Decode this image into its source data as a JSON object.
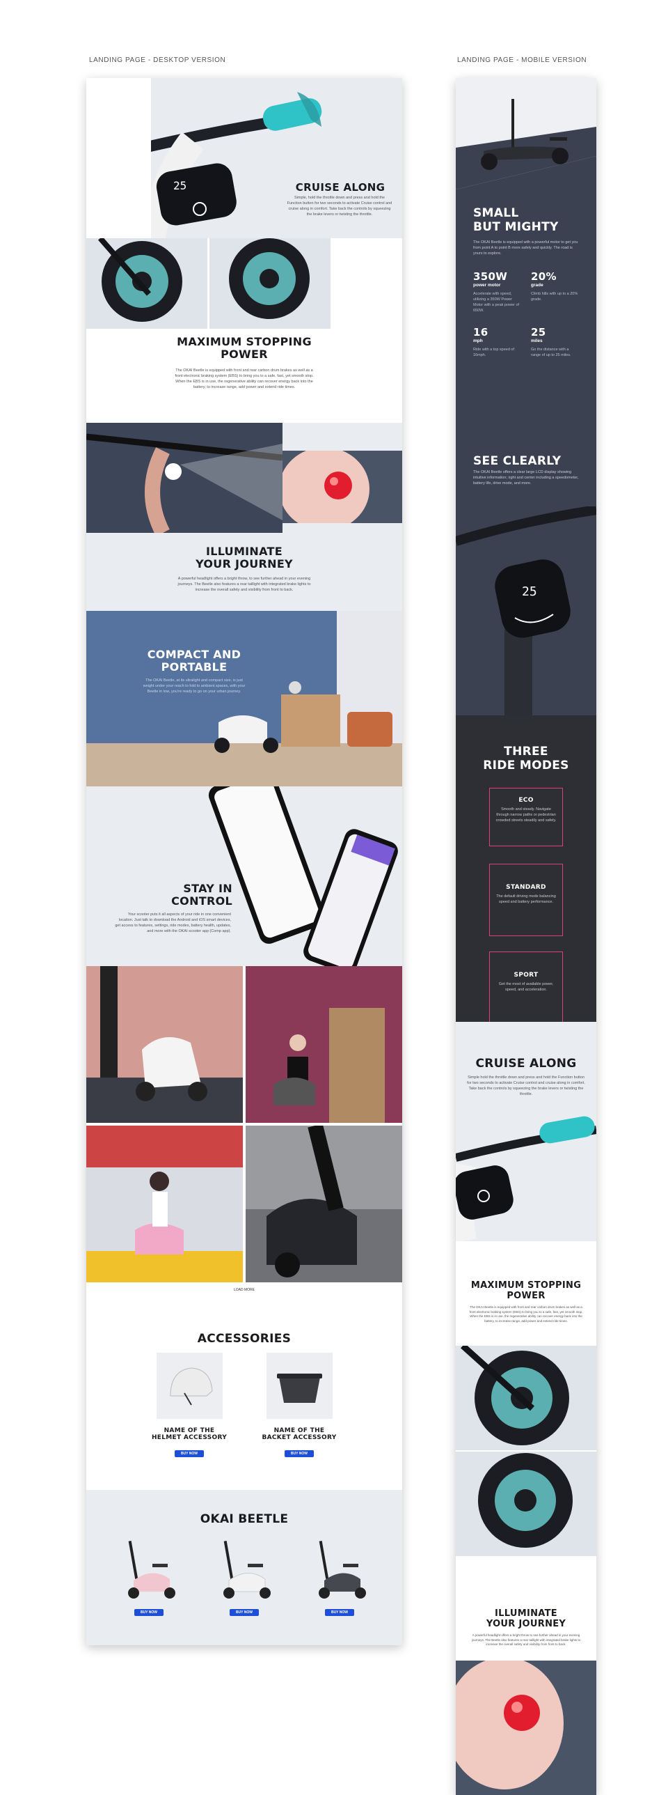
{
  "captions": {
    "desktop": "LANDING PAGE - DESKTOP VERSION",
    "mobile": "LANDING PAGE - MOBILE VERSION"
  },
  "display_readout": "25",
  "colors": {
    "accent": "#2fc3c7",
    "button": "#1d4ed8",
    "slate": "#3b4150",
    "pink": "#e0407a"
  },
  "desktop": {
    "cruise": {
      "title": "CRUISE ALONG",
      "text": "Simple, hold the throttle down and press and hold the Function button for two seconds to activate Cruise control and cruise along in comfort. Take back the controls by squeezing the brake levers or twisting the throttle."
    },
    "stopping": {
      "title_1": "MAXIMUM STOPPING",
      "title_2": "POWER",
      "text": "The OKAI Beetle is equipped with front and rear carbon drum brakes as well as a front electronic braking system (EBS) to bring you to a safe, fast, yet smooth stop. When the EBS is in use, the regenerative ability can recover energy back into the battery, to increase range, add power and extend ride times."
    },
    "illuminate": {
      "title_1": "ILLUMINATE",
      "title_2": "YOUR JOURNEY",
      "text": "A powerful headlight offers a bright throw, to see further ahead in your evening journeys. The Beetle also features a rear taillight with integrated brake lights to increase the overall safety and visibility from front to back."
    },
    "compact": {
      "title_1": "COMPACT AND",
      "title_2": "PORTABLE",
      "text": "The OKAI Beetle, at its ultralight and compact size, is just weight under your reach to fold to ambient spaces, with your Beetle in tow, you’re ready to go on your urban journey."
    },
    "control": {
      "title_1": "STAY IN",
      "title_2": "CONTROL",
      "text": "Your scooter puts it all aspects of your ride in one convenient location. Just talk to download the Android and iOS smart devices, get access to features, settings, ride modes, battery health, updates, and more with the OKAI scooter app (Comp app)."
    },
    "load_more": "LOAD MORE",
    "accessories": {
      "title": "ACCESSORIES",
      "items": [
        {
          "name_1": "NAME OF THE",
          "name_2": "HELMET ACCESSORY",
          "button": "BUY NOW"
        },
        {
          "name_1": "NAME OF THE",
          "name_2": "BACKET ACCESSORY",
          "button": "BUY NOW"
        }
      ]
    },
    "beetle": {
      "title": "OKAI BEETLE",
      "buttons": [
        "BUY NOW",
        "BUY NOW",
        "BUY NOW"
      ],
      "scooter_colors": [
        "#f2c6cf",
        "#f2f2f2",
        "#45484f"
      ]
    }
  },
  "mobile": {
    "small": {
      "title_1": "SMALL",
      "title_2": "BUT MIGHTY",
      "text": "The OKAI Beetle is equipped with a powerful motor to get you from point A to point B more safely and quickly. The road is yours to explore.",
      "stats": [
        {
          "value": "350W",
          "label": "power motor",
          "desc": "Accelerate with speed, utilizing a 350W Power Motor with a peak power of 650W."
        },
        {
          "value": "20%",
          "label": "grade",
          "desc": "Climb hills with up to a 20% grade."
        },
        {
          "value": "16",
          "label": "mph",
          "desc": "Ride with a top speed of 16mph."
        },
        {
          "value": "25",
          "label": "miles",
          "desc": "Go the distance with a range of up to 25 miles."
        }
      ]
    },
    "see": {
      "title": "SEE CLEARLY",
      "text": "The OKAI Beetle offers a clear large LCD display showing intuitive information; right and center including a speedometer, battery life, drive mode, and more."
    },
    "modes": {
      "title_1": "THREE",
      "title_2": "RIDE MODES",
      "items": [
        {
          "name": "ECO",
          "text": "Smooth and steady. Navigate through narrow paths or pedestrian crowded streets steadily and safely."
        },
        {
          "name": "STANDARD",
          "text": "The default driving mode balancing speed and battery performance."
        },
        {
          "name": "SPORT",
          "text": "Get the most of available power, speed, and acceleration."
        }
      ]
    },
    "cruise": {
      "title": "CRUISE ALONG",
      "text": "Simple hold the throttle down and press and hold the Function button for two seconds to activate Cruise control and cruise along in comfort. Take back the controls by squeezing the brake levers or twisting the throttle."
    },
    "stopping": {
      "title_1": "MAXIMUM STOPPING",
      "title_2": "POWER",
      "text": "The OKAI Beetle is equipped with front and rear carbon drum brakes as well as a front electronic braking system (EBS) to bring you to a safe, fast, yet smooth stop. When the EBS is in use, the regenerative ability can recover energy back into the battery, to increase range, add power and extend ride times."
    },
    "illuminate": {
      "title_1": "ILLUMINATE",
      "title_2": "YOUR JOURNEY",
      "text": "A powerful headlight offers a bright throw to see further ahead in your evening journeys. The Beetle also features a rear taillight with integrated brake lights to increase the overall safety and visibility from front to back."
    }
  }
}
